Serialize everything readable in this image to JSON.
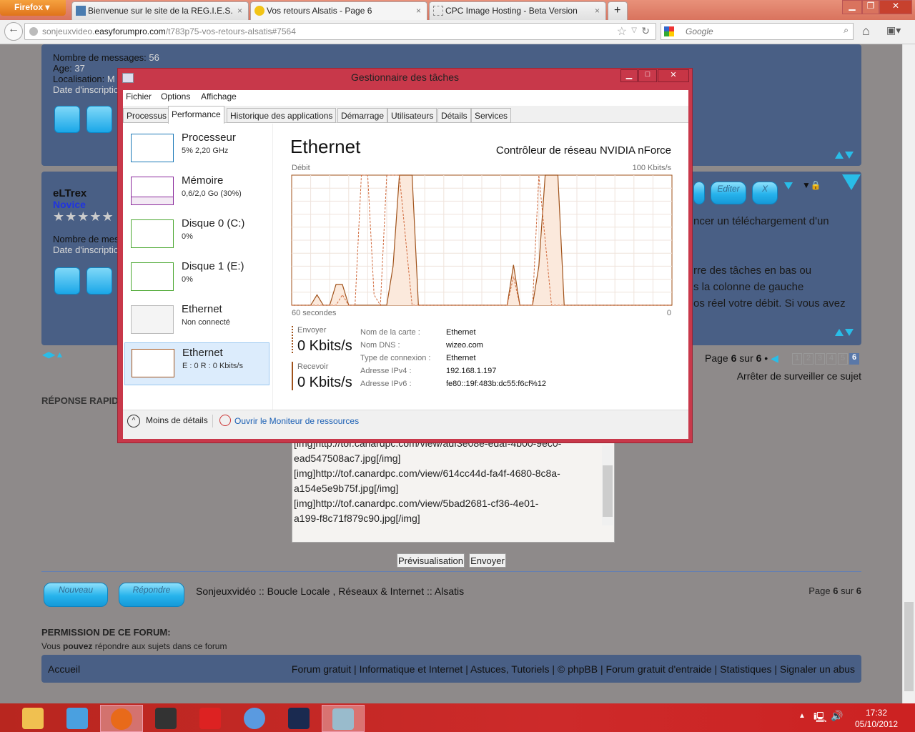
{
  "browser": {
    "menu_button": "Firefox",
    "tabs": [
      {
        "title": "Bienvenue sur le site de la REG.I.E.S.",
        "active": false
      },
      {
        "title": "Vos retours Alsatis - Page 6",
        "active": true
      },
      {
        "title": "CPC Image Hosting - Beta Version",
        "active": false
      }
    ],
    "url_prefix": "sonjeuxvideo.",
    "url_domain": "easyforumpro.com",
    "url_path": "/t783p75-vos-retours-alsatis#7564",
    "search_placeholder": "Google"
  },
  "forum": {
    "post1": {
      "messages_label": "Nombre de messages:",
      "messages": "56",
      "age_label": "Age:",
      "age": "37",
      "location_label": "Localisation:",
      "location": "M",
      "joined_label": "Date d'inscriptio"
    },
    "post2": {
      "username": "eLTrex",
      "rank": "Novice",
      "messages_label": "Nombre de mes",
      "joined_label": "Date d'inscriptio",
      "edit_label": "Editer",
      "delete_label": "X",
      "body_lines": [
        "ncer un téléchargement d'un",
        "rre des tâches en bas ou",
        "s la colonne de gauche",
        "os réel votre débit. Si vous avez"
      ]
    },
    "pagination": {
      "page_label": "Page",
      "current": "6",
      "of_label": "sur",
      "total": "6",
      "pages": [
        "1",
        "2",
        "3",
        "4",
        "5",
        "6"
      ]
    },
    "unwatch": "Arrêter de surveiller ce sujet",
    "quick_reply": "RÉPONSE RAPIDE",
    "textarea_lines": [
      "[img]http://tof.canardpc.com/view/adf3e08e-edaf-4b00-9ec0-",
      "ead547508ac7.jpg[/img]",
      "[img]http://tof.canardpc.com/view/614cc44d-fa4f-4680-8c8a-",
      "a154e5e9b75f.jpg[/img]",
      "[img]http://tof.canardpc.com/view/5bad2681-cf36-4e01-",
      "a199-f8c71f879c90.jpg[/img]"
    ],
    "preview_button": "Prévisualisation",
    "send_button": "Envoyer",
    "new_button": "Nouveau",
    "reply_button": "Répondre",
    "breadcrumb": "Sonjeuxvidéo :: Boucle Locale , Réseaux & Internet :: Alsatis",
    "permission_title": "PERMISSION DE CE FORUM:",
    "permission_pre": "Vous ",
    "permission_bold": "pouvez",
    "permission_post": " répondre aux sujets dans ce forum",
    "footer_home": "Accueil",
    "footer_links": "Forum gratuit | Informatique et Internet | Astuces, Tutoriels | © phpBB | Forum gratuit d'entraide | Statistiques | Signaler un abus"
  },
  "taskmanager": {
    "title": "Gestionnaire des tâches",
    "menu": [
      "Fichier",
      "Options",
      "Affichage"
    ],
    "tabs": [
      "Processus",
      "Performance",
      "Historique des applications",
      "Démarrage",
      "Utilisateurs",
      "Détails",
      "Services"
    ],
    "active_tab": "Performance",
    "resources": [
      {
        "name": "Processeur",
        "sub": "5%  2,20 GHz",
        "color": "#1d7ab8"
      },
      {
        "name": "Mémoire",
        "sub": "0,6/2,0 Go (30%)",
        "color": "#8b2a9c",
        "level": 0.3
      },
      {
        "name": "Disque 0 (C:)",
        "sub": "0%",
        "color": "#4ca832"
      },
      {
        "name": "Disque 1 (E:)",
        "sub": "0%",
        "color": "#4ca832"
      },
      {
        "name": "Ethernet",
        "sub": "Non connecté",
        "color": "#bbbbbb"
      },
      {
        "name": "Ethernet",
        "sub": "E : 0 R : 0 Kbits/s",
        "color": "#a0521a",
        "selected": true
      }
    ],
    "detail": {
      "heading": "Ethernet",
      "adapter": "Contrôleur de réseau NVIDIA nForce",
      "graph_label": "Débit",
      "graph_max": "100 Kbits/s",
      "graph_left": "60 secondes",
      "graph_right": "0",
      "send_label": "Envoyer",
      "send_value": "0 Kbits/s",
      "recv_label": "Recevoir",
      "recv_value": "0 Kbits/s",
      "props": [
        {
          "k": "Nom de la carte :",
          "v": "Ethernet"
        },
        {
          "k": "Nom DNS :",
          "v": "wizeo.com"
        },
        {
          "k": "Type de connexion :",
          "v": "Ethernet"
        },
        {
          "k": "Adresse IPv4 :",
          "v": "192.168.1.197"
        },
        {
          "k": "Adresse IPv6 :",
          "v": "fe80::19f:483b:dc55:f6cf%12"
        }
      ],
      "graph": {
        "x_range_seconds": [
          60,
          0
        ],
        "y_range_kbits": [
          0,
          100
        ],
        "color": "#a0521a",
        "receive": [
          0,
          0,
          0,
          0,
          8,
          0,
          0,
          16,
          16,
          0,
          0,
          0,
          0,
          0,
          0,
          0,
          30,
          100,
          100,
          100,
          0,
          0,
          0,
          0,
          0,
          0,
          0,
          0,
          0,
          0,
          0,
          0,
          0,
          0,
          0,
          31,
          0,
          0,
          0,
          30,
          100,
          100,
          100,
          0,
          0,
          0,
          0,
          0,
          0,
          0,
          0,
          0,
          0,
          0,
          0,
          0,
          0,
          0,
          0,
          0,
          0
        ],
        "send": [
          0,
          0,
          0,
          0,
          0,
          0,
          0,
          0,
          8,
          0,
          0,
          100,
          100,
          8,
          0,
          100,
          100,
          100,
          50,
          0,
          0,
          0,
          0,
          0,
          0,
          0,
          0,
          0,
          0,
          0,
          0,
          0,
          0,
          0,
          0,
          22,
          0,
          0,
          0,
          100,
          50,
          0,
          0,
          0,
          0,
          0,
          0,
          0,
          0,
          0,
          0,
          0,
          0,
          0,
          0,
          0,
          0,
          0,
          0,
          0,
          0
        ]
      }
    },
    "less_details": "Moins de détails",
    "resource_monitor": "Ouvrir le Moniteur de ressources"
  },
  "taskbar": {
    "apps": [
      "file-explorer",
      "control-panel",
      "firefox",
      "steam",
      "guild-wars-2",
      "chrome",
      "league-of-legends",
      "task-manager"
    ],
    "active": [
      "firefox",
      "task-manager"
    ],
    "time": "17:32",
    "date": "05/10/2012"
  }
}
